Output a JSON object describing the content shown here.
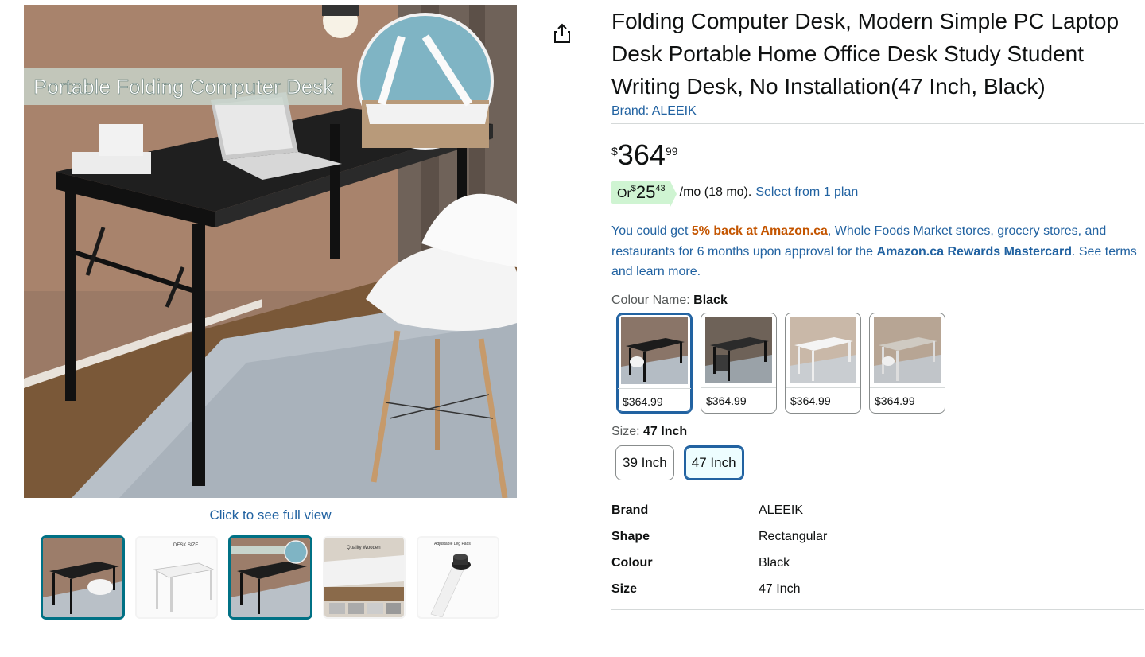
{
  "gallery": {
    "banner_text": "Portable Folding Computer Desk",
    "full_view_label": "Click to see full view",
    "thumbnails": [
      {
        "name": "thumb-black-desk",
        "selected": true
      },
      {
        "name": "thumb-dimensions",
        "selected": false
      },
      {
        "name": "thumb-black-desk-banner",
        "selected": true
      },
      {
        "name": "thumb-quality-wooden",
        "selected": false
      },
      {
        "name": "thumb-adjustable-leg-pads",
        "selected": false
      }
    ],
    "thumb_texts": {
      "dimensions": "DESK SIZE",
      "quality": "Quality Wooden",
      "leg_pads": "Adjustable Leg Pads"
    }
  },
  "share_icon": "share-icon",
  "product": {
    "title": "Folding Computer Desk, Modern Simple PC Laptop Desk Portable Home Office Desk Study Student Writing Desk, No Installation(47 Inch, Black)",
    "brand_link": "Brand: ALEEIK",
    "price": {
      "symbol": "$",
      "whole": "364",
      "fraction": "99"
    },
    "installment": {
      "prefix": "Or ",
      "symbol": "$",
      "whole": "25",
      "fraction": "43",
      "rest": "/mo (18 mo).",
      "link": "Select from 1 plan"
    },
    "rewards": {
      "part1": "You could get ",
      "highlight": "5% back at Amazon.ca",
      "part2": ", Whole Foods Market stores, grocery stores, and restaurants for 6 months upon approval for the ",
      "card": "Amazon.ca Rewards Mastercard",
      "part3": ". See terms and learn more."
    },
    "colour": {
      "label": "Colour Name: ",
      "value": "Black",
      "options": [
        {
          "price": "$364.99",
          "selected": true
        },
        {
          "price": "$364.99",
          "selected": false
        },
        {
          "price": "$364.99",
          "selected": false
        },
        {
          "price": "$364.99",
          "selected": false
        }
      ]
    },
    "size": {
      "label": "Size: ",
      "value": "47 Inch",
      "options": [
        {
          "label": "39 Inch",
          "selected": false
        },
        {
          "label": "47 Inch",
          "selected": true
        }
      ]
    },
    "specs": [
      {
        "key": "Brand",
        "value": "ALEEIK"
      },
      {
        "key": "Shape",
        "value": "Rectangular"
      },
      {
        "key": "Colour",
        "value": "Black"
      },
      {
        "key": "Size",
        "value": "47 Inch"
      }
    ]
  },
  "colors": {
    "link": "#2162a1",
    "deal_red": "#c45500",
    "installment_bg": "#cff4d2",
    "selected_border": "#2162a1",
    "thumb_selected": "#007185"
  }
}
